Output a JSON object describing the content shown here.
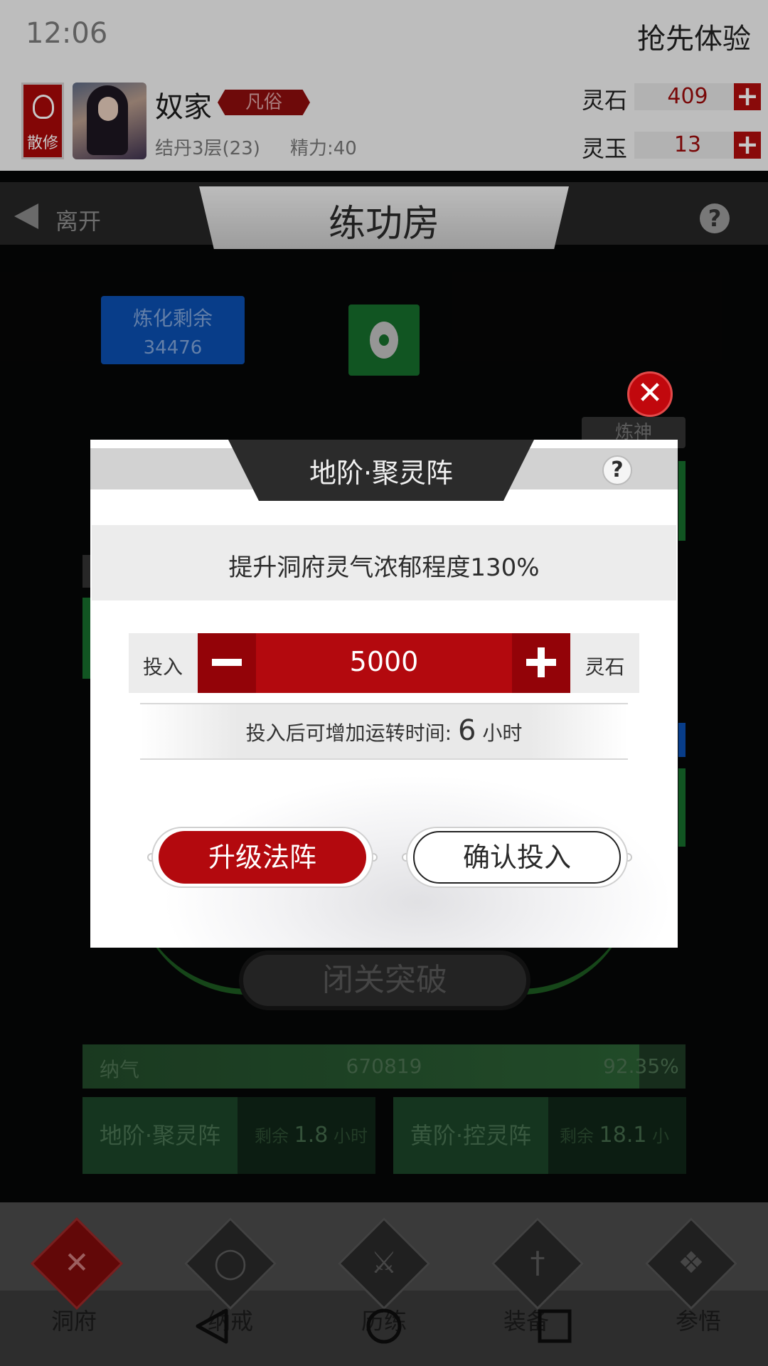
{
  "status_bar": {
    "time": "12:06",
    "promo": "抢先体验"
  },
  "player": {
    "sect": "散修",
    "name": "奴家",
    "rank": "凡俗",
    "level": "结丹3层(23)",
    "energy": "精力:40"
  },
  "resources": [
    {
      "label": "灵石",
      "value": "409",
      "plus": "+"
    },
    {
      "label": "灵玉",
      "value": "13",
      "plus": "+"
    }
  ],
  "header": {
    "leave": "离开",
    "title": "练功房",
    "help": "?"
  },
  "refine": {
    "label": "炼化剩余",
    "value": "34476"
  },
  "side_tab": "炼神",
  "breakthrough": "闭关突破",
  "qi": {
    "label": "纳气",
    "value": "670819",
    "percent": "92.35%",
    "fraction": 0.9235
  },
  "arrays": [
    {
      "name": "地阶·聚灵阵",
      "remain_prefix": "剩余",
      "remain_value": "1.8",
      "remain_unit": "小时"
    },
    {
      "name": "黄阶·控灵阵",
      "remain_prefix": "剩余",
      "remain_value": "18.1",
      "remain_unit": "小时"
    }
  ],
  "bottom_nav": [
    {
      "label": "洞府",
      "icon": "cross-icon",
      "active": true
    },
    {
      "label": "纳戒",
      "icon": "ring-icon",
      "active": false
    },
    {
      "label": "历练",
      "icon": "swords-icon",
      "active": false
    },
    {
      "label": "装备",
      "icon": "sword-icon",
      "active": false
    },
    {
      "label": "参悟",
      "icon": "book-icon",
      "active": false
    }
  ],
  "modal": {
    "title": "地阶·聚灵阵",
    "help": "?",
    "description": "提升洞府灵气浓郁程度130%",
    "invest_label": "投入",
    "amount": "5000",
    "unit": "灵石",
    "runtime_prefix": "投入后可增加运转时间:",
    "runtime_hours": "6",
    "runtime_unit": "小时",
    "upgrade_button": "升级法阵",
    "confirm_button": "确认投入"
  },
  "colors": {
    "accent": "#b3090e",
    "dark": "#2b2b2b",
    "green": "#176d2c",
    "blue": "#0b4fb0"
  }
}
